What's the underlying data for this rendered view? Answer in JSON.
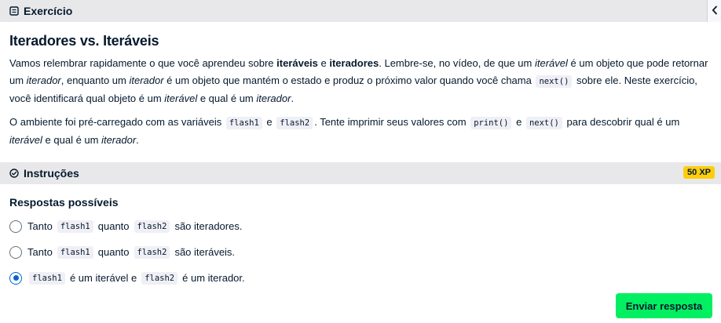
{
  "top_bar": {
    "title": "Exercício"
  },
  "exercise": {
    "title": "Iteradores vs. Iteráveis",
    "p1": {
      "t1": "Vamos relembrar rapidamente o que você aprendeu sobre ",
      "b1": "iteráveis",
      "t2": " e ",
      "b2": "iteradores",
      "t3": ". Lembre-se, no vídeo, de que um ",
      "i1": "iterável",
      "t4": " é um objeto que pode retornar um ",
      "i2": "iterador",
      "t5": ", enquanto um ",
      "i3": "iterador",
      "t6": " é um objeto que mantém o estado e produz o próximo valor quando você chama ",
      "c1": "next()",
      "t7": " sobre ele. Neste exercício, você identificará qual objeto é um ",
      "i4": "iterável",
      "t8": " e qual é um ",
      "i5": "iterador",
      "t9": "."
    },
    "p2": {
      "t1": "O ambiente foi pré-carregado com as variáveis ",
      "c1": "flash1",
      "t2": " e ",
      "c2": "flash2",
      "t3": ". Tente imprimir seus valores com ",
      "c3": "print()",
      "t4": " e ",
      "c4": "next()",
      "t5": " para descobrir qual é um ",
      "i1": "iterável",
      "t6": " e qual é um ",
      "i2": "iterador",
      "t7": "."
    }
  },
  "instructions": {
    "title": "Instruções",
    "xp": "50 XP"
  },
  "answers": {
    "heading": "Respostas possíveis",
    "options": [
      {
        "pre": "Tanto",
        "c1": "flash1",
        "mid": "quanto",
        "c2": "flash2",
        "post": "são iteradores.",
        "selected": false
      },
      {
        "pre": "Tanto",
        "c1": "flash1",
        "mid": "quanto",
        "c2": "flash2",
        "post": "são iteráveis.",
        "selected": false
      },
      {
        "pre": "",
        "c1": "flash1",
        "mid": "é um iterável e",
        "c2": "flash2",
        "post": "é um iterador.",
        "selected": true
      }
    ]
  },
  "submit_label": "Enviar resposta",
  "colors": {
    "accent_blue": "#0065d1",
    "submit_green": "#03ef62",
    "xp_yellow": "#fcce0d",
    "bar_bg": "#e8e8ea"
  },
  "icons": {
    "exercise": "document-icon",
    "instructions": "check-circle-icon",
    "collapse": "chevron-left-icon"
  }
}
